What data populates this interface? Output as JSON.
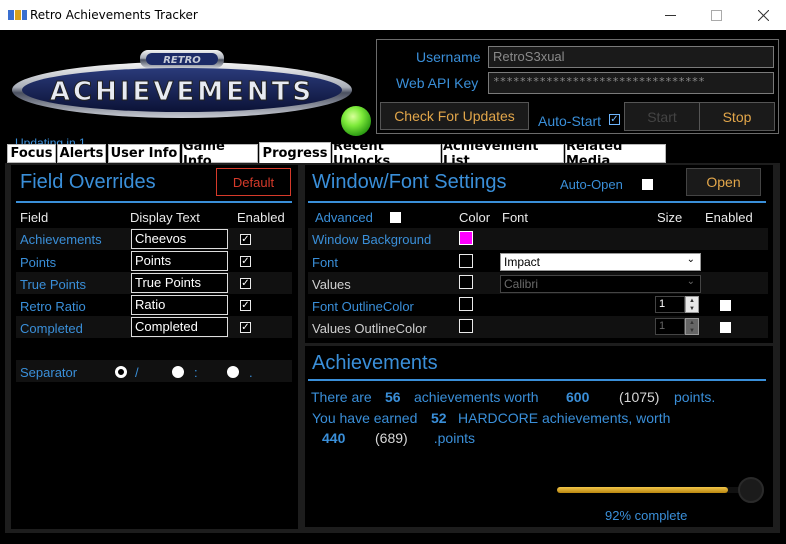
{
  "window": {
    "title": "Retro Achievements Tracker",
    "minimize_icon": "minimize-icon",
    "maximize_icon": "maximize-icon",
    "close_icon": "close-icon"
  },
  "header": {
    "logo_text": "ACHIEVEMENTS",
    "logo_badge": "RETRO",
    "updating": "Updating in 1...",
    "username_label": "Username",
    "username_value": "RetroS3xual",
    "apikey_label": "Web API Key",
    "apikey_value": "********************************",
    "check_updates": "Check For Updates",
    "autostart_label": "Auto-Start",
    "autostart_checked": true,
    "start": "Start",
    "stop": "Stop"
  },
  "tabs": [
    {
      "label": "Focus"
    },
    {
      "label": "Alerts"
    },
    {
      "label": "User Info"
    },
    {
      "label": "Game Info"
    },
    {
      "label": "Progress",
      "active": true
    },
    {
      "label": "Recent Unlocks"
    },
    {
      "label": "Achievement List"
    },
    {
      "label": "Related Media"
    }
  ],
  "field_overrides": {
    "title": "Field Overrides",
    "default_button": "Default",
    "col_field": "Field",
    "col_display": "Display Text",
    "col_enabled": "Enabled",
    "rows": [
      {
        "field": "Achievements",
        "display": "Cheevos",
        "enabled": true
      },
      {
        "field": "Points",
        "display": "Points",
        "enabled": true
      },
      {
        "field": "True Points",
        "display": "True Points",
        "enabled": true
      },
      {
        "field": "Retro Ratio",
        "display": "Ratio",
        "enabled": true
      },
      {
        "field": "Completed",
        "display": "Completed",
        "enabled": true
      }
    ],
    "separator_label": "Separator",
    "separators": [
      "/",
      ":",
      "."
    ],
    "separator_selected": 0
  },
  "window_font": {
    "title": "Window/Font Settings",
    "autoopen_label": "Auto-Open",
    "open_button": "Open",
    "advanced_label": "Advanced",
    "col_color": "Color",
    "col_font": "Font",
    "col_size": "Size",
    "col_enabled": "Enabled",
    "rows": [
      {
        "label": "Window Background",
        "color": "#ff00ff"
      },
      {
        "label": "Font",
        "font": "Impact"
      },
      {
        "label": "Values",
        "font": "Calibri"
      },
      {
        "label": "Font OutlineColor",
        "size": "1"
      },
      {
        "label": "Values OutlineColor",
        "size": "1"
      }
    ]
  },
  "achievements": {
    "title": "Achievements",
    "line1": {
      "a": "There are",
      "count": "56",
      "b": "achievements worth",
      "points": "600",
      "total": "(1075)",
      "c": "points."
    },
    "line2": {
      "a": "You have earned",
      "count": "52",
      "b": "HARDCORE achievements, worth"
    },
    "line3": {
      "points": "440",
      "total": "(689)",
      "c": "points."
    },
    "progress_percent": 92,
    "progress_text": "92% complete"
  },
  "colors": {
    "accent_blue": "#3a8fd9",
    "accent_orange": "#e2a64a",
    "default_red": "#d63a2a",
    "progress_gold": "#d4a21c"
  }
}
